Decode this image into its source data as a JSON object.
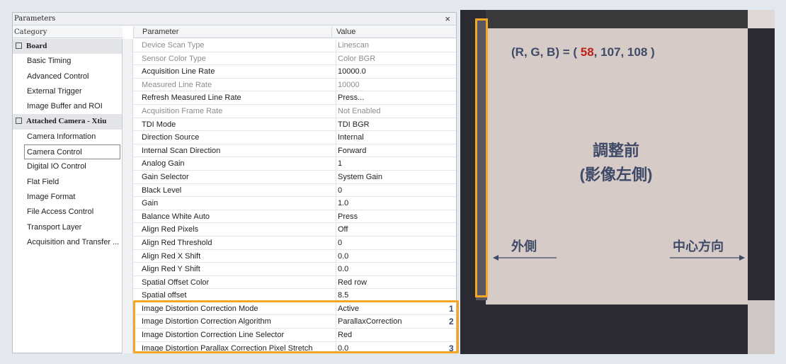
{
  "window": {
    "title": "Parameters",
    "close_glyph": "×"
  },
  "columns": {
    "category": "Category",
    "parameter": "Parameter",
    "value": "Value"
  },
  "categories": [
    {
      "label": "Board",
      "type": "group"
    },
    {
      "label": "Basic Timing",
      "type": "item"
    },
    {
      "label": "Advanced Control",
      "type": "item"
    },
    {
      "label": "External Trigger",
      "type": "item"
    },
    {
      "label": "Image Buffer and ROI",
      "type": "item"
    },
    {
      "label": "Attached Camera - Xtiu",
      "type": "group"
    },
    {
      "label": "Camera Information",
      "type": "item"
    },
    {
      "label": "Camera Control",
      "type": "selected"
    },
    {
      "label": "Digital IO Control",
      "type": "item"
    },
    {
      "label": "Flat Field",
      "type": "item"
    },
    {
      "label": "Image Format",
      "type": "item"
    },
    {
      "label": "File Access Control",
      "type": "item"
    },
    {
      "label": "Transport Layer",
      "type": "item"
    },
    {
      "label": "Acquisition and Transfer ...",
      "type": "item"
    }
  ],
  "parameters": [
    {
      "name": "Device Scan Type",
      "value": "Linescan",
      "dim": true
    },
    {
      "name": "Sensor Color Type",
      "value": "Color BGR",
      "dim": true
    },
    {
      "name": "Acquisition Line Rate",
      "value": "10000.0",
      "dim": false
    },
    {
      "name": "Measured Line Rate",
      "value": "10000",
      "dim": true
    },
    {
      "name": "Refresh Measured Line Rate",
      "value": "Press...",
      "dim": false
    },
    {
      "name": "Acquisition Frame Rate",
      "value": "Not Enabled",
      "dim": true
    },
    {
      "name": "TDI Mode",
      "value": "TDI BGR",
      "dim": false
    },
    {
      "name": "Direction Source",
      "value": "Internal",
      "dim": false
    },
    {
      "name": "Internal Scan Direction",
      "value": "Forward",
      "dim": false
    },
    {
      "name": "Analog Gain",
      "value": "1",
      "dim": false
    },
    {
      "name": "Gain Selector",
      "value": "System Gain",
      "dim": false
    },
    {
      "name": "Black Level",
      "value": "0",
      "dim": false
    },
    {
      "name": "Gain",
      "value": "1.0",
      "dim": false
    },
    {
      "name": "Balance White Auto",
      "value": "Press",
      "dim": false
    },
    {
      "name": "Align Red Pixels",
      "value": "Off",
      "dim": false
    },
    {
      "name": "Align Red Threshold",
      "value": "0",
      "dim": false
    },
    {
      "name": "Align Red X Shift",
      "value": "0.0",
      "dim": false
    },
    {
      "name": "Align Red Y Shift",
      "value": "0.0",
      "dim": false
    },
    {
      "name": "Spatial Offset Color",
      "value": "Red row",
      "dim": false
    },
    {
      "name": "Spatial offset",
      "value": "8.5",
      "dim": false
    },
    {
      "name": "Image Distortion Correction Mode",
      "value": "Active",
      "dim": false,
      "marker": "1"
    },
    {
      "name": "Image Distortion Correction Algorithm",
      "value": "ParallaxCorrection",
      "dim": false,
      "marker": "2"
    },
    {
      "name": "Image Distortion Correction Line Selector",
      "value": "Red",
      "dim": false,
      "marker": ""
    },
    {
      "name": "Image Distortion Parallax Correction Pixel Stretch",
      "value": "0.0",
      "dim": false,
      "marker": "3"
    }
  ],
  "overlay": {
    "rgb_prefix": "(R, G, B) = ( ",
    "rgb_r": "58",
    "rgb_rest": ", 107, 108 )",
    "title_line1": "調整前",
    "title_line2": "(影像左側)",
    "left_label": "外側",
    "right_label": "中心方向"
  },
  "colors": {
    "highlight": "#f5a623",
    "accent_text": "#3e4a68",
    "red_value": "#c0201a"
  }
}
